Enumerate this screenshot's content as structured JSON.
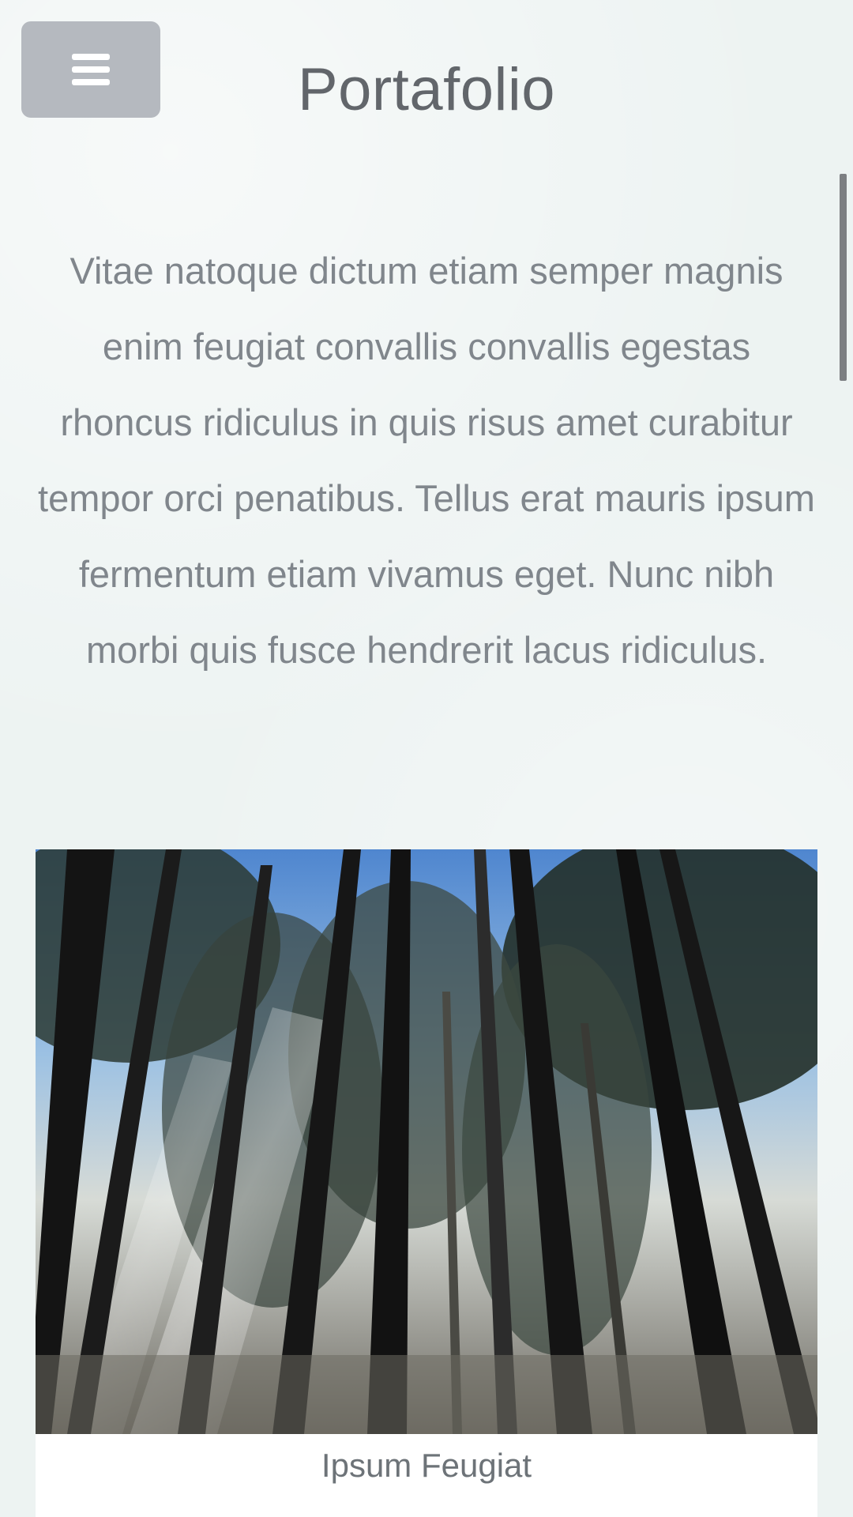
{
  "header": {
    "title": "Portafolio",
    "menu_icon": "hamburger-icon"
  },
  "intro": {
    "text": "Vitae natoque dictum etiam semper magnis enim feugiat convallis convallis egestas rhoncus ridiculus in quis risus amet curabitur tempor orci penatibus. Tellus erat mauris ipsum fermentum etiam vivamus eget. Nunc nibh morbi quis fusce hendrerit lacus ridiculus."
  },
  "portfolio": {
    "items": [
      {
        "caption": "Ipsum Feugiat",
        "image_subject": "forest-trees-sunlight"
      }
    ]
  },
  "colors": {
    "background": "#edf3f2",
    "menu_button": "#b5b9bf",
    "title_text": "#62666b",
    "body_text": "#80868c"
  }
}
